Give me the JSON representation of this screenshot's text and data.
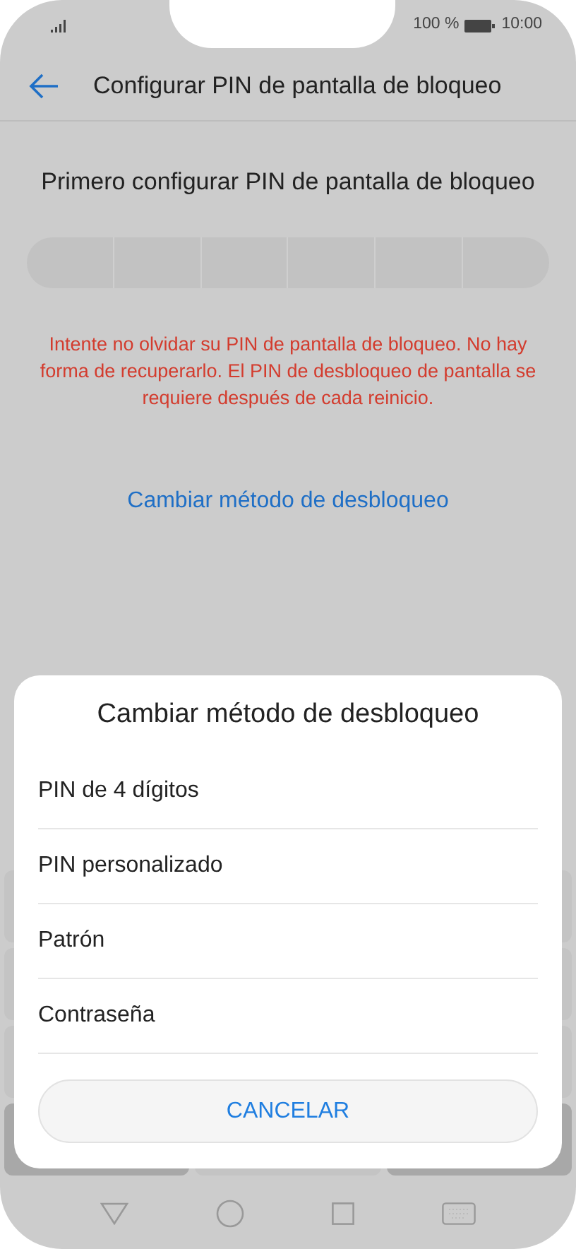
{
  "status_bar": {
    "battery": "100 %",
    "time": "10:00"
  },
  "header": {
    "title": "Configurar PIN de pantalla de bloqueo"
  },
  "prompt": "Primero configurar PIN de pantalla de bloqueo",
  "warning": "Intente no olvidar su PIN de pantalla de bloqueo. No hay forma de recuperarlo. El PIN de desbloqueo de pantalla se requiere después de cada reinicio.",
  "change_method_link": "Cambiar método de desbloqueo",
  "sheet": {
    "title": "Cambiar método de desbloqueo",
    "options": [
      {
        "label": "PIN de 4 dígitos"
      },
      {
        "label": "PIN personalizado"
      },
      {
        "label": "Patrón"
      },
      {
        "label": "Contraseña"
      }
    ],
    "cancel": "CANCELAR"
  }
}
